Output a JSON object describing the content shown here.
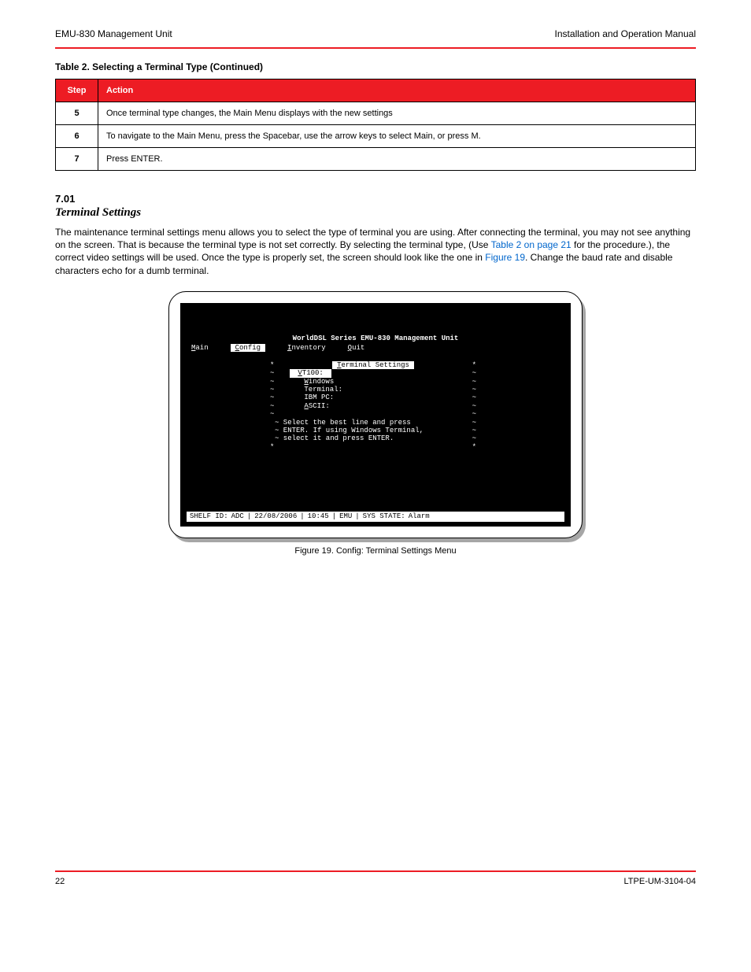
{
  "header": {
    "left": "EMU-830 Management Unit",
    "right": "Installation and Operation Manual"
  },
  "table": {
    "title": "Table 2.  Selecting a Terminal Type (Continued)",
    "cols": {
      "step": "Step",
      "action": "Action"
    },
    "rows": [
      {
        "step": "5",
        "action_html": "Once terminal type changes, the Main Menu displays with the new settings"
      },
      {
        "step": "6",
        "action_html": "To navigate to the Main Menu, press the Spacebar, use the arrow keys to select <span class='bold'>Main</span>, or press <span class='bold'>M</span>."
      },
      {
        "step": "7",
        "action_html": "Press <span class='bold'>ENTER</span>."
      }
    ]
  },
  "section": {
    "num": "7.01",
    "title": "Terminal Settings",
    "para_html": "The maintenance terminal settings menu allows you to select the type of terminal you are using. After connecting the terminal, you may not see anything on the screen. That is because the terminal type is not set correctly. By selecting the terminal type, (Use <span class='xref'>Table 2 on page 21</span> for the procedure.), the correct video settings will be used. Once the type is properly set, the screen should look like the one in <span class='xref'>Figure 19</span>. Change the baud rate and disable characters echo for a dumb terminal."
  },
  "terminal": {
    "title": "WorldDSL Series EMU-830 Management Unit",
    "menubar": {
      "items": [
        {
          "label": "Main",
          "underline": "M",
          "selected": false
        },
        {
          "label": "Config",
          "underline": "C",
          "selected": true
        },
        {
          "label": "Inventory",
          "underline": "I",
          "selected": false
        },
        {
          "label": "Quit",
          "underline": "Q",
          "selected": false
        }
      ]
    },
    "dialog": {
      "title": "Terminal Settings",
      "title_underline": "T",
      "options": [
        {
          "label": "VT100:",
          "underline": "V",
          "selected": true
        },
        {
          "label": "Windows",
          "underline": "W",
          "selected": false
        },
        {
          "label": "Terminal:",
          "underline": "",
          "selected": false
        },
        {
          "label": "IBM PC:",
          "underline": "",
          "selected": false
        },
        {
          "label": "ASCII:",
          "underline": "A",
          "selected": false
        }
      ],
      "help_lines": [
        "~ Select the best line and press",
        "~ ENTER.  If using Windows Terminal,",
        "~ select it and press ENTER."
      ]
    },
    "status": {
      "shelf_label": "SHELF ID: ",
      "shelf_value": "ADC",
      "date": "22/08/2006",
      "time": "10:45",
      "mode": "EMU",
      "state_label": "SYS STATE: ",
      "state_value": "Alarm"
    }
  },
  "figure_caption": "Figure 19.  Config: Terminal Settings Menu",
  "footer": {
    "left": "22",
    "right": "LTPE-UM-3104-04"
  }
}
